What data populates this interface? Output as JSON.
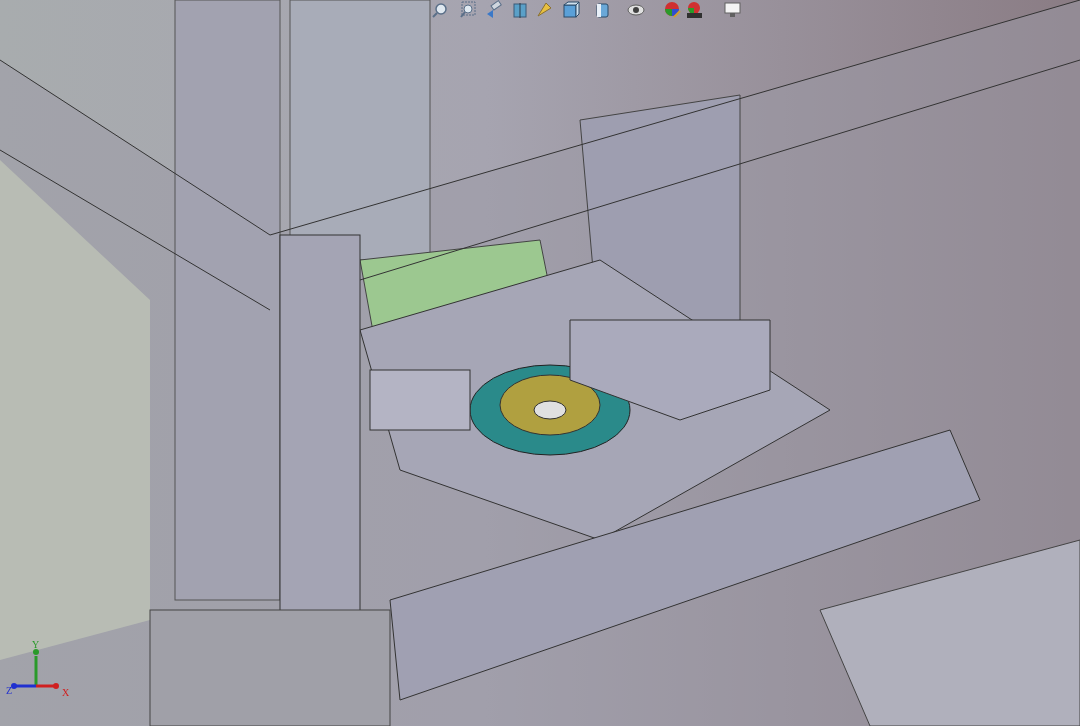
{
  "toolbar": {
    "icons": [
      {
        "kind": "zoom-fit"
      },
      {
        "kind": "zoom-area"
      },
      {
        "kind": "previous-view"
      },
      {
        "kind": "section-view"
      },
      {
        "kind": "dynamic-annotation"
      },
      {
        "kind": "view-orientation"
      },
      {
        "kind": "display-style"
      },
      {
        "kind": "hide-show"
      },
      {
        "kind": "edit-appearance"
      },
      {
        "kind": "apply-scene"
      },
      {
        "kind": "view-settings"
      }
    ]
  },
  "triad": {
    "axes": [
      {
        "label": "Y",
        "color": "#2a9a2a"
      },
      {
        "label": "Z",
        "color": "#2030d0"
      },
      {
        "label": "X",
        "color": "#d02020"
      }
    ]
  }
}
